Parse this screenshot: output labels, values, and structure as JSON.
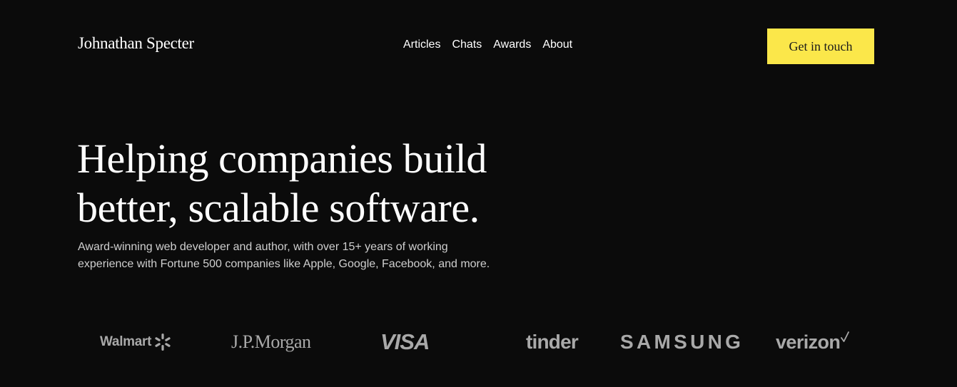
{
  "header": {
    "brand": "Johnathan Specter",
    "nav": [
      {
        "label": "Articles"
      },
      {
        "label": "Chats"
      },
      {
        "label": "Awards"
      },
      {
        "label": "About"
      }
    ],
    "cta_label": "Get in touch",
    "cta_color": "#fbe74a"
  },
  "hero": {
    "headline_line1": "Helping companies build",
    "headline_line2": "better, scalable software.",
    "subtext": "Award-winning web developer and author, with over 15+ years of working experience with Fortune 500 companies like Apple, Google, Facebook, and more."
  },
  "logos": [
    {
      "name": "Walmart",
      "icon": "walmart-spark-icon"
    },
    {
      "name": "J.P.Morgan"
    },
    {
      "name": "VISA"
    },
    {
      "name": "tinder"
    },
    {
      "name": "SAMSUNG"
    },
    {
      "name": "verizon",
      "icon": "verizon-check-icon"
    }
  ],
  "colors": {
    "background": "#0b0b0b",
    "accent": "#fbe74a",
    "logo_gray": "#a9a9a9"
  }
}
